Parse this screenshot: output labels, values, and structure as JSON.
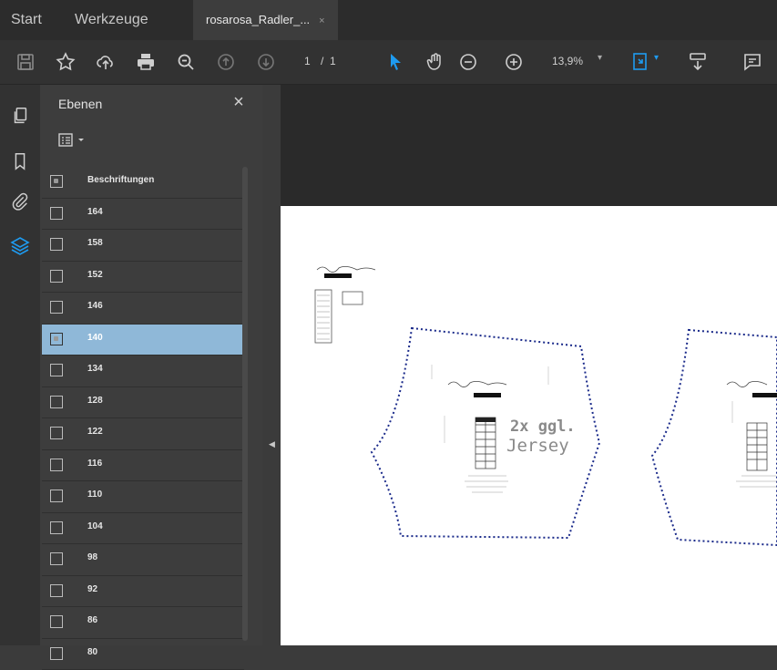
{
  "tabs": {
    "start": "Start",
    "tools": "Werkzeuge",
    "doc": "rosarosa_Radler_...",
    "doc_close": "×"
  },
  "toolbar": {
    "page_current": "1",
    "page_sep": "/",
    "page_total": "1",
    "zoom": "13,9%"
  },
  "layers_panel": {
    "title": "Ebenen",
    "close": "×",
    "items": [
      {
        "label": "Beschriftungen",
        "visible": true
      },
      {
        "label": "164",
        "visible": false
      },
      {
        "label": "158",
        "visible": false
      },
      {
        "label": "152",
        "visible": false
      },
      {
        "label": "146",
        "visible": false
      },
      {
        "label": "140",
        "visible": true,
        "selected": true
      },
      {
        "label": "134",
        "visible": false
      },
      {
        "label": "128",
        "visible": false
      },
      {
        "label": "122",
        "visible": false
      },
      {
        "label": "116",
        "visible": false
      },
      {
        "label": "110",
        "visible": false
      },
      {
        "label": "104",
        "visible": false
      },
      {
        "label": "98",
        "visible": false
      },
      {
        "label": "92",
        "visible": false
      },
      {
        "label": "86",
        "visible": false
      },
      {
        "label": "80",
        "visible": false
      }
    ]
  },
  "document": {
    "piece_text_1": "2x ggl.",
    "piece_text_2": "Jersey"
  },
  "colors": {
    "accent": "#1e9bf0",
    "selected_row": "#8fb8d8",
    "seam_line": "#1a2a8a"
  }
}
